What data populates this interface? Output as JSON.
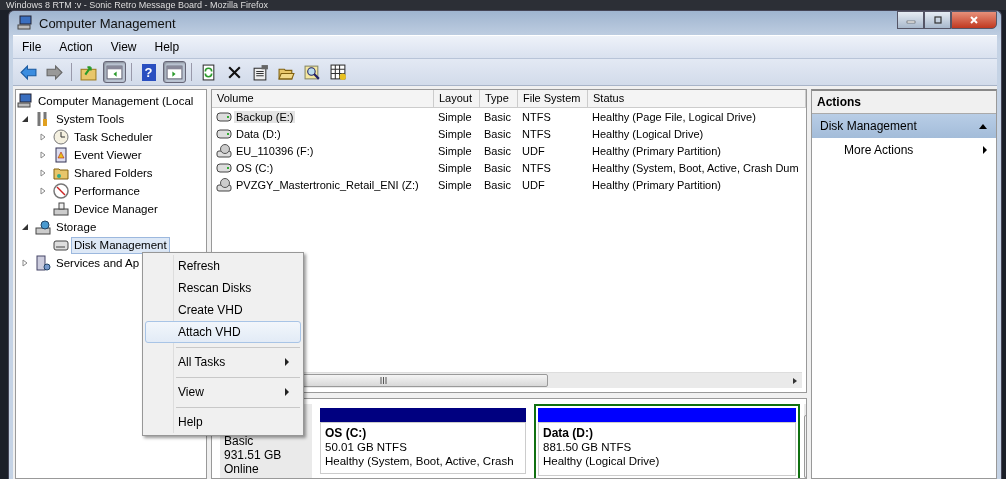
{
  "background_window": {
    "title": "Windows 8 RTM :v - Sonic Retro Message Board - Mozilla Firefox"
  },
  "window": {
    "title": "Computer Management"
  },
  "menu_bar": [
    "File",
    "Action",
    "View",
    "Help"
  ],
  "toolbar": [
    {
      "kind": "back",
      "pressed": false
    },
    {
      "kind": "forward",
      "pressed": false
    },
    {
      "kind": "up",
      "pressed": false
    },
    {
      "kind": "tree",
      "pressed": true
    },
    {
      "kind": "help",
      "label": "?",
      "pressed": false
    },
    {
      "kind": "pane",
      "pressed": true
    },
    {
      "kind": "refresh",
      "pressed": false
    },
    {
      "kind": "delete",
      "pressed": false
    },
    {
      "kind": "properties",
      "pressed": false
    },
    {
      "kind": "open",
      "pressed": false
    },
    {
      "kind": "find",
      "pressed": false
    },
    {
      "kind": "grid",
      "pressed": false
    }
  ],
  "tree": [
    {
      "label": "Computer Management (Local",
      "selected": false,
      "children": [
        {
          "label": "System Tools",
          "expanded": true,
          "selected": false,
          "children": [
            {
              "label": "Task Scheduler",
              "expanded": false,
              "selected": false
            },
            {
              "label": "Event Viewer",
              "expanded": false,
              "selected": false
            },
            {
              "label": "Shared Folders",
              "expanded": false,
              "selected": false
            },
            {
              "label": "Performance",
              "expanded": false,
              "selected": false
            },
            {
              "label": "Device Manager",
              "selected": false
            }
          ]
        },
        {
          "label": "Storage",
          "expanded": true,
          "selected": false,
          "children": [
            {
              "label": "Disk Management",
              "selected": true
            }
          ]
        },
        {
          "label": "Services and Ap",
          "expanded": false,
          "selected": false
        }
      ]
    }
  ],
  "table": {
    "columns": [
      "Volume",
      "Layout",
      "Type",
      "File System",
      "Status"
    ],
    "rows": [
      {
        "kind": "drive",
        "selected": true,
        "cells": [
          "Backup (E:)",
          "Simple",
          "Basic",
          "NTFS",
          "Healthy (Page File, Logical Drive)"
        ]
      },
      {
        "kind": "drive",
        "selected": false,
        "cells": [
          "Data (D:)",
          "Simple",
          "Basic",
          "NTFS",
          "Healthy (Logical Drive)"
        ]
      },
      {
        "kind": "disc",
        "selected": false,
        "cells": [
          "EU_110396 (F:)",
          "Simple",
          "Basic",
          "UDF",
          "Healthy (Primary Partition)"
        ]
      },
      {
        "kind": "drive",
        "selected": false,
        "cells": [
          "OS (C:)",
          "Simple",
          "Basic",
          "NTFS",
          "Healthy (System, Boot, Active, Crash Dum"
        ]
      },
      {
        "kind": "disc",
        "selected": false,
        "cells": [
          "PVZGY_Mastertronic_Retail_ENI (Z:)",
          "Simple",
          "Basic",
          "UDF",
          "Healthy (Primary Partition)"
        ]
      }
    ]
  },
  "disk": {
    "lines": [
      "Basic",
      "931.51 GB",
      "Online"
    ],
    "partitions": [
      {
        "name": "OS  (C:)",
        "size": "50.01 GB NTFS",
        "status": "Healthy (System, Boot, Active, Crash",
        "color": "#000080",
        "selected": false
      },
      {
        "name": "Data  (D:)",
        "size": "881.50 GB NTFS",
        "status": "Healthy (Logical Drive)",
        "color": "#0000ff",
        "selected": true
      }
    ]
  },
  "context_menu": [
    {
      "label": "Refresh",
      "selected": false,
      "submenu": false,
      "separator_before": false
    },
    {
      "label": "Rescan Disks",
      "selected": false,
      "submenu": false,
      "separator_before": false
    },
    {
      "label": "Create VHD",
      "selected": false,
      "submenu": false,
      "separator_before": false
    },
    {
      "label": "Attach VHD",
      "selected": true,
      "submenu": false,
      "separator_before": false
    },
    {
      "label": "All Tasks",
      "selected": false,
      "submenu": true,
      "separator_before": true
    },
    {
      "label": "View",
      "selected": false,
      "submenu": true,
      "separator_before": true
    },
    {
      "label": "Help",
      "selected": false,
      "submenu": false,
      "separator_before": true
    }
  ],
  "actions": {
    "title": "Actions",
    "section": {
      "label": "Disk Management",
      "expanded": true
    },
    "items": [
      {
        "label": "More Actions",
        "submenu": true
      }
    ]
  }
}
